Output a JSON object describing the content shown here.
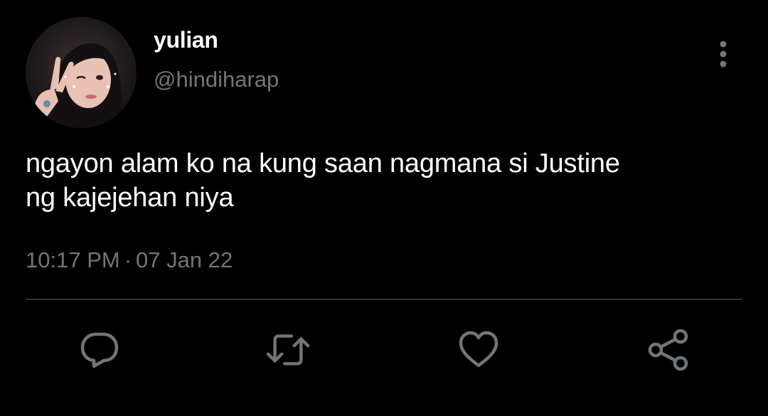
{
  "tweet": {
    "author": {
      "display_name": "yulian",
      "handle": "@hindiharap"
    },
    "text_lines": [
      "ngayon alam ko na kung saan nagmana si Justine",
      "ng kajejehan niya"
    ],
    "time": "10:17 PM",
    "separator": "·",
    "date": "07 Jan 22"
  },
  "actions": {
    "reply_icon": "reply-icon",
    "retweet_icon": "retweet-icon",
    "like_icon": "heart-icon",
    "share_icon": "share-icon",
    "more_icon": "more-vertical-icon"
  },
  "colors": {
    "background": "#000000",
    "text_primary": "#ffffff",
    "text_secondary": "#71767b",
    "divider": "#2f3336",
    "icon": "#71767b"
  }
}
